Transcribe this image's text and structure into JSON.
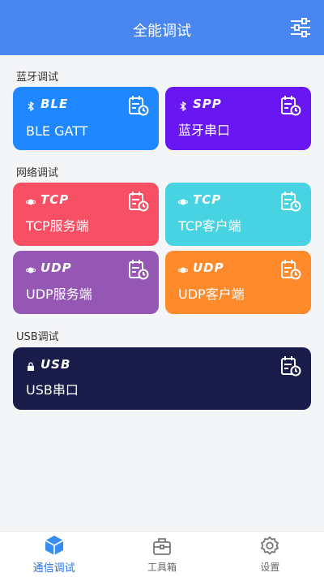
{
  "header": {
    "title": "全能调试"
  },
  "sections": {
    "bluetooth": "蓝牙调试",
    "network": "网络调试",
    "usb": "USB调试"
  },
  "cards": {
    "ble": {
      "badge": "BLE",
      "name": "BLE GATT",
      "color": "#1f87ff"
    },
    "spp": {
      "badge": "SPP",
      "name": "蓝牙串口",
      "color": "#6816f2"
    },
    "tcp_server": {
      "badge": "TCP",
      "name": "TCP服务端",
      "color": "#f74f63"
    },
    "tcp_client": {
      "badge": "TCP",
      "name": "TCP客户端",
      "color": "#48d3e2"
    },
    "udp_server": {
      "badge": "UDP",
      "name": "UDP服务端",
      "color": "#9458b4"
    },
    "udp_client": {
      "badge": "UDP",
      "name": "UDP客户端",
      "color": "#ff8a2c"
    },
    "usb": {
      "badge": "USB",
      "name": "USB串口",
      "color": "#1a1c4a"
    }
  },
  "tabbar": {
    "items": [
      {
        "label": "通信调试",
        "icon": "cube-icon",
        "active": true
      },
      {
        "label": "工具箱",
        "icon": "toolbox-icon",
        "active": false
      },
      {
        "label": "设置",
        "icon": "gear-icon",
        "active": false
      }
    ]
  },
  "colors": {
    "header": "#4a86f0",
    "accent": "#2a73e8"
  }
}
